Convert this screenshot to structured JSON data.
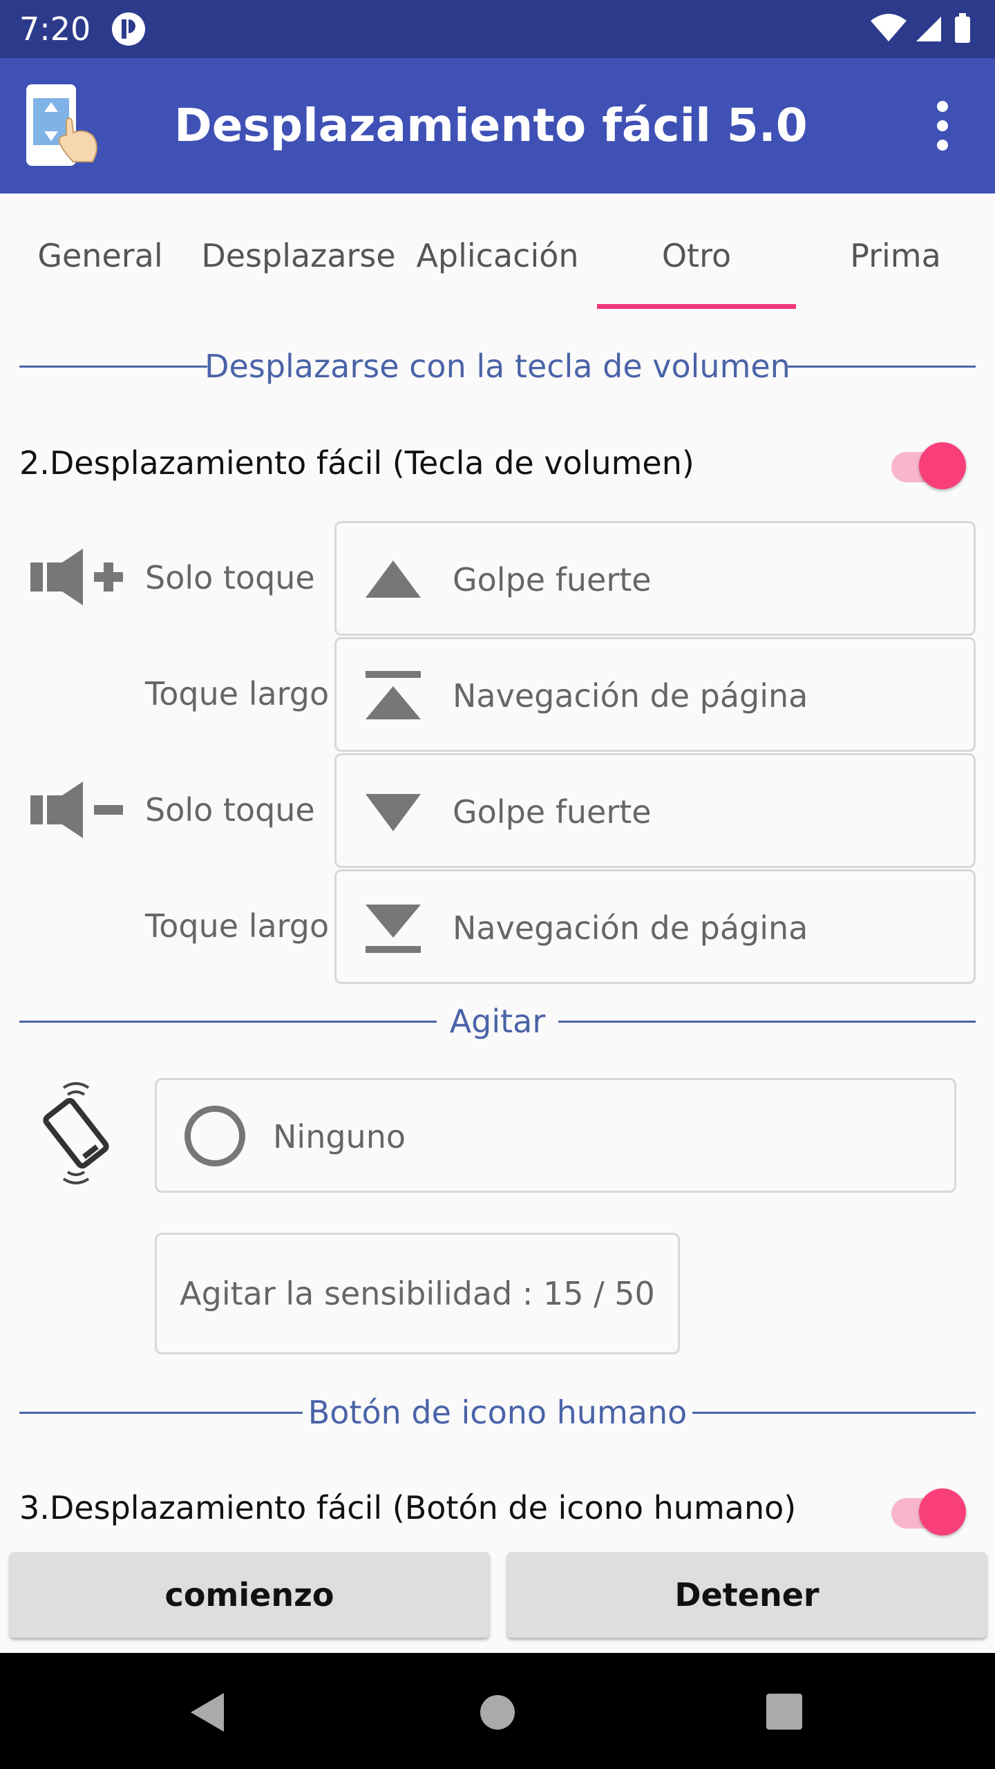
{
  "status_bar": {
    "time": "7:20"
  },
  "app_bar": {
    "title": "Desplazamiento fácil 5.0",
    "menu_icon": "more-vert-icon"
  },
  "tabs": [
    {
      "label": "General",
      "selected": false
    },
    {
      "label": "Desplazarse",
      "selected": false
    },
    {
      "label": "Aplicación",
      "selected": false
    },
    {
      "label": "Otro",
      "selected": true
    },
    {
      "label": "Prima",
      "selected": false
    }
  ],
  "volume_section": {
    "title": "Desplazarse con la tecla de volumen",
    "toggle_label": "2.Desplazamiento fácil (Tecla de volumen)",
    "toggle_on": true,
    "rows": [
      {
        "key_icon": "volume-up-icon",
        "press": "Solo toque",
        "action_icon": "triangle-up-icon",
        "action": "Golpe fuerte"
      },
      {
        "key_icon": "",
        "press": "Toque largo",
        "action_icon": "page-up-icon",
        "action": "Navegación de página"
      },
      {
        "key_icon": "volume-down-icon",
        "press": "Solo toque",
        "action_icon": "triangle-down-icon",
        "action": "Golpe fuerte"
      },
      {
        "key_icon": "",
        "press": "Toque largo",
        "action_icon": "page-down-icon",
        "action": "Navegación de página"
      }
    ]
  },
  "shake_section": {
    "title": "Agitar",
    "option": "Ninguno",
    "sensitivity": "Agitar la sensibilidad : 15 / 50"
  },
  "human_icon_section": {
    "title": "Botón de icono humano",
    "toggle_label": "3.Desplazamiento fácil (Botón de icono humano)",
    "toggle_on": true
  },
  "buttons": {
    "start": "comienzo",
    "stop": "Detener"
  },
  "colors": {
    "primary": "#3f51b5",
    "primary_dark": "#2c3a8c",
    "accent": "#f83f7a",
    "section": "#4a63a8"
  }
}
